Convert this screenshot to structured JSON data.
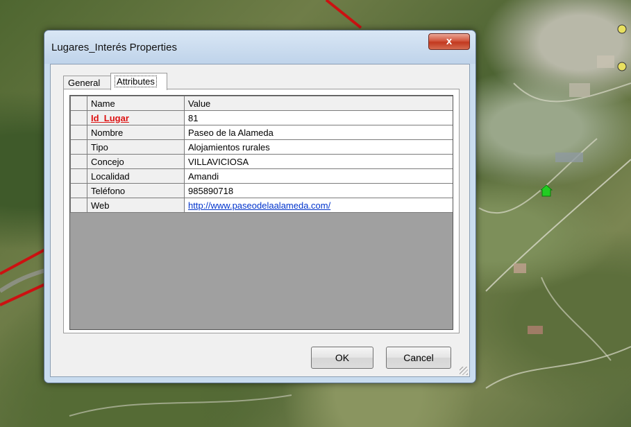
{
  "window": {
    "title": "Lugares_Interés Properties",
    "close_glyph": "x"
  },
  "tabs": [
    {
      "label": "General"
    },
    {
      "label": "Attributes"
    }
  ],
  "grid": {
    "headers": {
      "name": "Name",
      "value": "Value"
    },
    "rows": [
      {
        "name": "Id_Lugar",
        "value": "81",
        "key": true
      },
      {
        "name": "Nombre",
        "value": "Paseo de la Alameda"
      },
      {
        "name": "Tipo",
        "value": "Alojamientos rurales"
      },
      {
        "name": "Concejo",
        "value": "VILLAVICIOSA"
      },
      {
        "name": "Localidad",
        "value": "Amandi"
      },
      {
        "name": "Teléfono",
        "value": "985890718"
      },
      {
        "name": "Web",
        "value": "http://www.paseodelaalameda.com/",
        "link": true
      }
    ]
  },
  "buttons": {
    "ok": "OK",
    "cancel": "Cancel"
  },
  "colors": {
    "key_field": "#dd1111",
    "link": "#0033cc",
    "map_marker": "#22cc22",
    "road": "#cc1111"
  },
  "map_marker_icon": "house-marker-icon"
}
